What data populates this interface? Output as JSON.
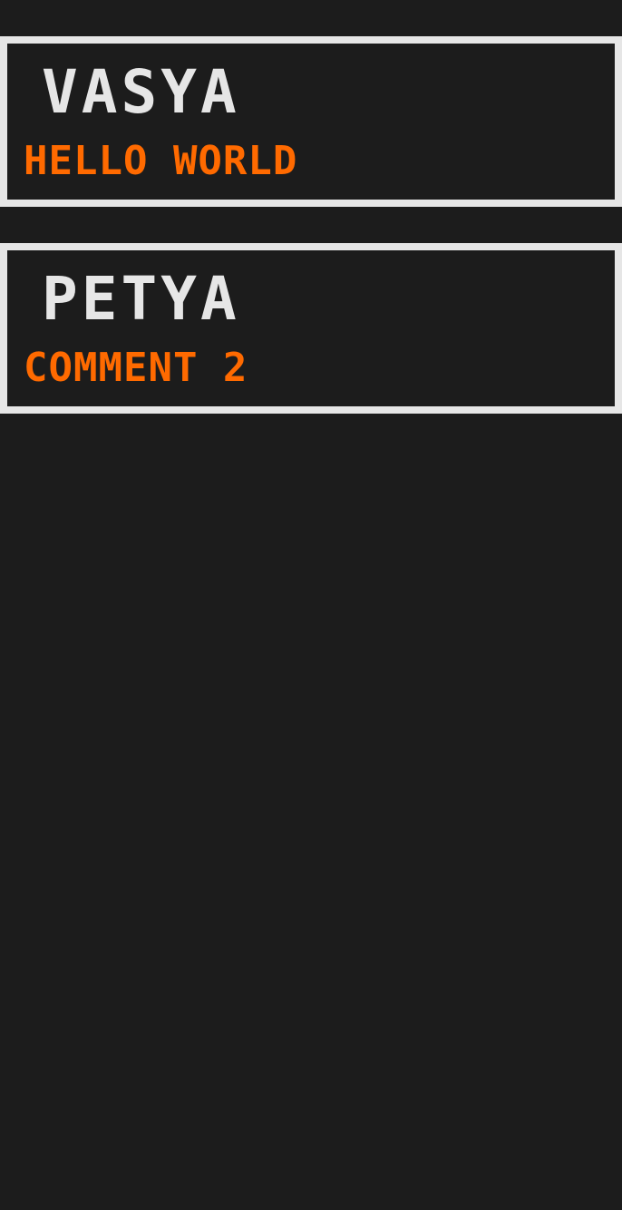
{
  "colors": {
    "background": "#1c1c1c",
    "card_border": "#e6e6e6",
    "author_text": "#e6e6e6",
    "comment_text": "#ff6a00"
  },
  "comments": [
    {
      "author": "VASYA",
      "text": "HELLO WORLD"
    },
    {
      "author": "PETYA",
      "text": "COMMENT 2"
    }
  ]
}
